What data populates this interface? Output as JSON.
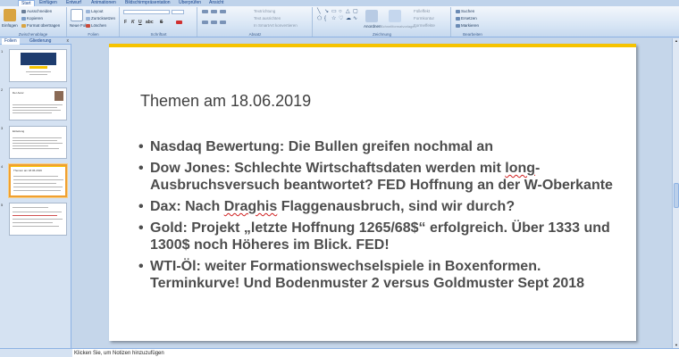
{
  "ribbon": {
    "tabs": [
      "Start",
      "Einfügen",
      "Entwurf",
      "Animationen",
      "Bildschirmpräsentation",
      "Überprüfen",
      "Ansicht"
    ],
    "clipboard": {
      "label": "Zwischenablage",
      "paste": "Einfügen",
      "cut": "Ausschneiden",
      "copy": "Kopieren",
      "format_painter": "Format übertragen"
    },
    "slides": {
      "label": "Folien",
      "new_slide": "Neue Folie",
      "layout": "Layout",
      "reset": "Zurücksetzen",
      "delete": "Löschen"
    },
    "font": {
      "label": "Schriftart",
      "bold": "F",
      "italic": "K",
      "underline": "U",
      "strike": "S",
      "shadow": "abc"
    },
    "paragraph": {
      "label": "Absatz",
      "text_direction": "Textrichtung",
      "align_text": "Text ausrichten",
      "smartart": "In SmartArt konvertieren"
    },
    "drawing": {
      "label": "Zeichnung",
      "arrange": "Anordnen",
      "quick_styles": "Schnellformatvorlagen",
      "fill": "Fülleffekt",
      "outline": "Formkontur",
      "effects": "Formeffekte"
    },
    "editing": {
      "label": "Bearbeiten",
      "find": "Suchen",
      "replace": "Ersetzen",
      "select": "Markieren"
    }
  },
  "panel": {
    "tabs": [
      "Folien",
      "Gliederung"
    ],
    "close": "x",
    "slide_numbers": [
      "1",
      "2",
      "3",
      "4",
      "5"
    ],
    "thumb_titles": [
      "",
      "Der Autor",
      "Einleitung",
      "Themen am 18.06.2019",
      ""
    ]
  },
  "slide": {
    "accent_color": "#f6c300",
    "title": "Themen am 18.06.2019",
    "bullets": [
      {
        "text": "Nasdaq Bewertung: Die Bullen greifen nochmal an"
      },
      {
        "pre": "Dow Jones: Schlechte Wirtschaftsdaten werden mit ",
        "marked": "long",
        "post": "-Ausbruchsversuch beantwortet? FED Hoffnung an der W-Oberkante"
      },
      {
        "pre": "Dax: Nach ",
        "marked": "Draghis",
        "post": " Flaggenausbruch, sind wir durch?"
      },
      {
        "text": "Gold: Projekt „letzte Hoffnung 1265/68$“ erfolgreich. Über 1333 und 1300$ noch Höheres im Blick. FED!"
      },
      {
        "text": "WTI-Öl:  weiter Formationswechselspiele in Boxenformen. Terminkurve! Und Bodenmuster 2 versus Goldmuster Sept 2018"
      }
    ]
  },
  "notes": {
    "placeholder": "Klicken Sie, um Notizen hinzuzufügen"
  },
  "scrollbar": {
    "up": "▲",
    "down": "▼"
  }
}
